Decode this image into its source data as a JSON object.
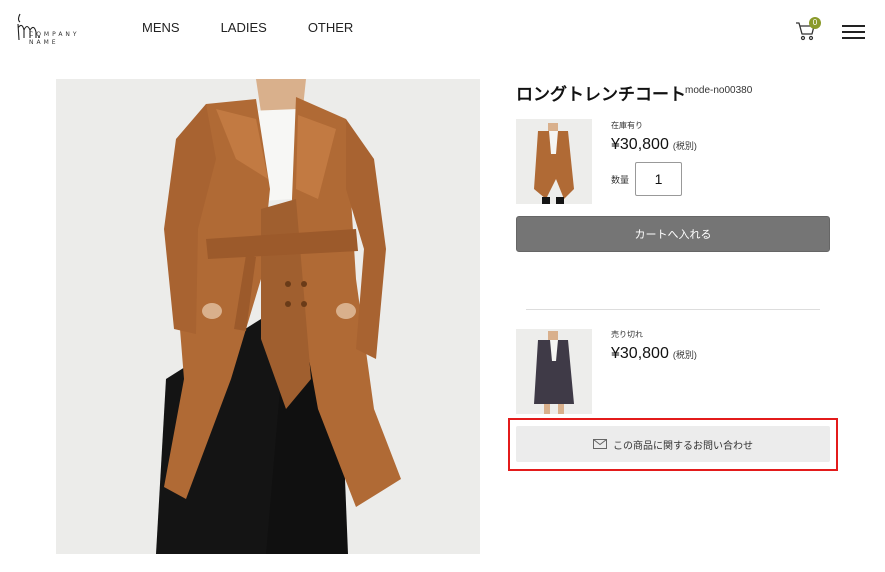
{
  "header": {
    "logo_mark": "m.",
    "logo_line1": "COMPANY",
    "logo_line2": "NAME",
    "nav": [
      "MENS",
      "LADIES",
      "OTHER"
    ],
    "cart_count": "0"
  },
  "product": {
    "title": "ロングトレンチコート",
    "code": "mode-no00380",
    "variants": [
      {
        "stock": "在庫有り",
        "price": "¥30,800",
        "tax": "(税別)",
        "color": "#b06a35"
      },
      {
        "stock": "売り切れ",
        "price": "¥30,800",
        "tax": "(税別)",
        "color": "#3f3a47"
      }
    ],
    "quantity_label": "数量",
    "quantity_value": "1",
    "add_to_cart": "カートへ入れる",
    "inquiry": "この商品に関するお問い合わせ"
  },
  "colors": {
    "accent_badge": "#8a9a2a",
    "highlight": "#e31b1b",
    "cart_button": "#757575"
  }
}
